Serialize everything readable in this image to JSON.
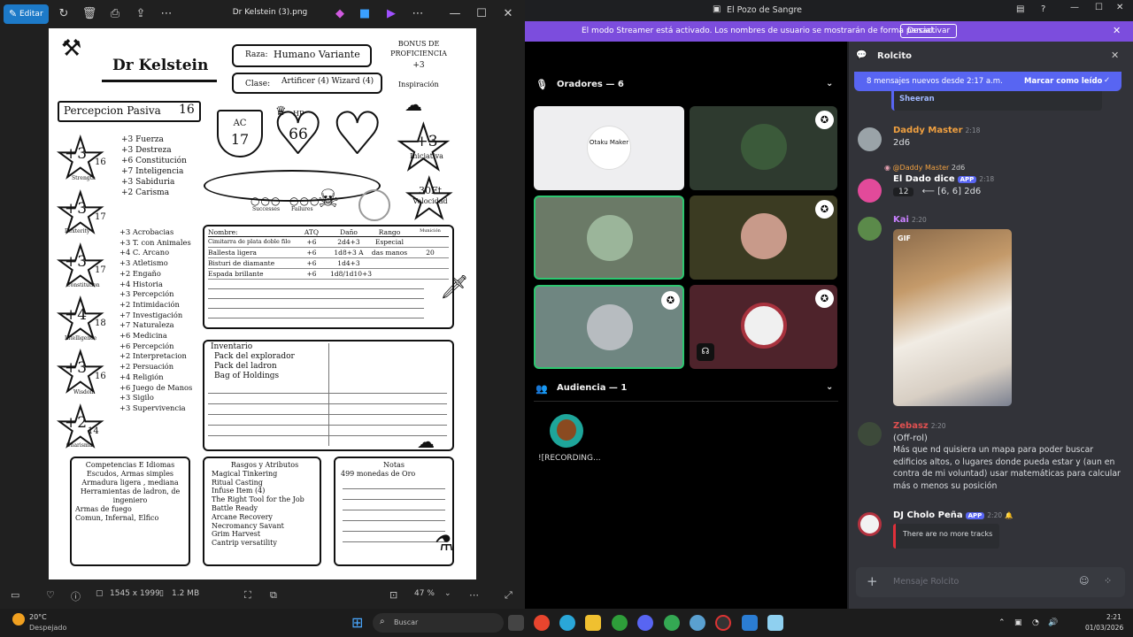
{
  "viewer": {
    "edit_label": "Editar",
    "title": "Dr Kelstein (3).png",
    "dimensions": "1545 x 1999",
    "filesize": "1.2 MB",
    "zoom": "47 %"
  },
  "sheet": {
    "name": "Dr Kelstein",
    "race_label": "Raza:",
    "race": "Humano Variante",
    "class_label": "Clase:",
    "class": "Artificer (4) Wizard (4)",
    "prof_label": "BONUS DE PROFICIENCIA",
    "prof": "+3",
    "inspiration": "Inspiración",
    "passive_label": "Percepcion Pasiva",
    "passive": "16",
    "ac_label": "AC",
    "ac": "17",
    "hp_label": "HP",
    "hp": "66",
    "initiative": "+3",
    "initiative_label": "Iniciativa",
    "speed": "30Ft",
    "speed_label": "Velocidad",
    "successes": "Successes",
    "failures": "Failures",
    "stats": [
      {
        "mod": "+3",
        "score": "16",
        "name": "Strength"
      },
      {
        "mod": "+3",
        "score": "17",
        "name": "Dexterity"
      },
      {
        "mod": "+3",
        "score": "17",
        "name": "Constitution"
      },
      {
        "mod": "+4",
        "score": "18",
        "name": "Intelligence"
      },
      {
        "mod": "+3",
        "score": "16",
        "name": "Wisdom"
      },
      {
        "mod": "+2",
        "score": "14",
        "name": "Charisma"
      }
    ],
    "saves": [
      "+3 Fuerza",
      "+3 Destreza",
      "+6 Constitución",
      "+7 Inteligencia",
      "+3 Sabiduria",
      "+2 Carisma"
    ],
    "skills": [
      "+3 Acrobacias",
      "+3 T. con Animales",
      "+4 C. Arcano",
      "+3 Atletismo",
      "+2 Engaño",
      "+4 Historia",
      "+3 Percepción",
      "+2 Intimidación",
      "+7 Investigación",
      "+7 Naturaleza",
      "+6 Medicina",
      "+6 Percepción",
      "+2 Interpretacion",
      "+2 Persuación",
      "+4 Religión",
      "+6 Juego de Manos",
      "+3 Sigilo",
      "+3 Supervivencia"
    ],
    "attacks_header": [
      "Nombre:",
      "ATQ",
      "Daño",
      "Rango",
      "Munición"
    ],
    "attacks": [
      [
        "Cimitarra de plata doble filo",
        "+6",
        "2d4+3",
        "Especial",
        ""
      ],
      [
        "Ballesta ligera",
        "+6",
        "1d8+3 A",
        "das manos",
        "20"
      ],
      [
        "Bisturi de diamante",
        "+6",
        "1d4+3",
        "",
        ""
      ],
      [
        "Espada brillante",
        "+6",
        "1d8/1d10+3",
        "",
        ""
      ]
    ],
    "inventory_title": "Inventario",
    "inventory": [
      "Pack del explorador",
      "Pack del ladron",
      "Bag of Holdings"
    ],
    "comp_title": "Competencias E Idiomas",
    "comp": [
      "Escudos, Armas simples",
      "Armadura ligera , mediana",
      "Herramientas de ladron, de ingeniero",
      "Armas de fuego",
      "Comun, Infernal, Elfico"
    ],
    "traits_title": "Rasgos y Atributos",
    "traits": [
      "Magical Tinkering",
      "Ritual Casting",
      "Infuse Item (4)",
      "The Right Tool for the Job",
      "Battle Ready",
      "Arcane Recovery",
      "Necromancy Savant",
      "Grim Harvest",
      "Cantrip versatility"
    ],
    "notes_title": "Notas",
    "notes": [
      "499 monedas de Oro"
    ]
  },
  "discord": {
    "server": "El Pozo de Sangre",
    "banner": "El modo Streamer está activado. Los nombres de usuario se mostrarán de forma parcial.",
    "deactivate": "Desactivar",
    "speakers_label": "Oradores — 6",
    "audience_label": "Audiencia — 1",
    "audience_member": "![RECORDING...",
    "otaku_text": "Otaku Maker",
    "chat_title": "Rolcito",
    "new_msgs": "8 mensajes nuevos desde 2:17 a.m.",
    "mark_read": "Marcar como leído",
    "prev_name": "Sheeran",
    "messages": [
      {
        "user": "Daddy Master",
        "time": "2:18",
        "text": "2d6",
        "color": "#f0a040"
      },
      {
        "reply_to": "@Daddy Master",
        "reply_text": "2d6",
        "user": "El Dado dice",
        "app": "APP",
        "time": "2:18",
        "result": "12",
        "detail": "⟵ [6, 6] 2d6",
        "color": "#ffffff"
      },
      {
        "user": "Kai",
        "time": "2:20",
        "gif": "GIF",
        "color": "#c880ff"
      },
      {
        "user": "Zebasz",
        "time": "2:20",
        "text1": "(Off-rol)",
        "text2": "Más que nd quisiera un mapa para poder buscar edificios altos, o lugares donde pueda estar y (aun en contra de mi voluntad) usar matemáticas para calcular más o menos su posición",
        "color": "#e05050"
      },
      {
        "user": "DJ Cholo Peña",
        "app": "APP",
        "time": "2:20",
        "embed": "There are no more tracks",
        "color": "#ffffff"
      }
    ],
    "input_placeholder": "Mensaje Rolcito"
  },
  "taskbar": {
    "temp": "20°C",
    "weather": "Despejado",
    "search": "Buscar",
    "time": "2:21",
    "date": "01/03/2026"
  }
}
